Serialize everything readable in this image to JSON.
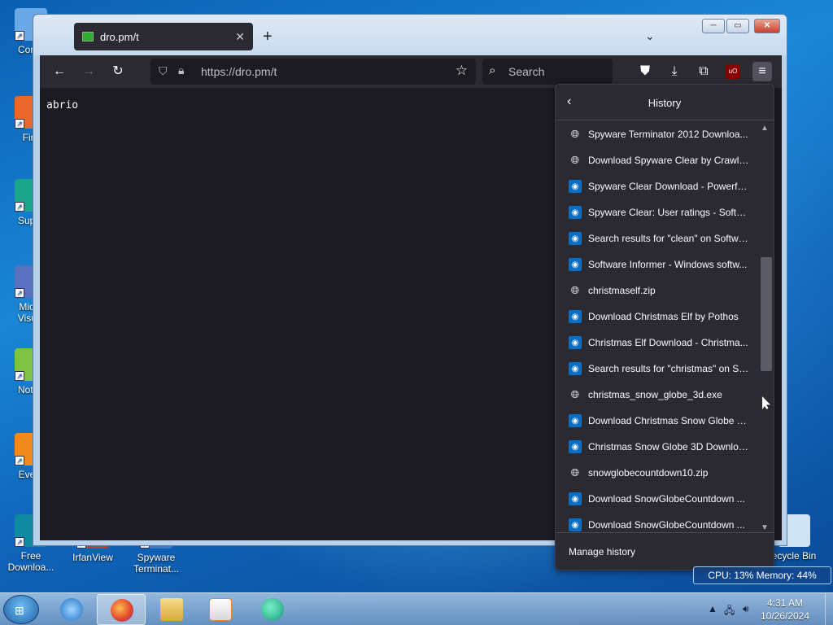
{
  "desktop": {
    "icons": [
      {
        "label": "Comp",
        "color": "#6aa8e6"
      },
      {
        "label": "Fire",
        "color": "#e8672a"
      },
      {
        "label": "Super",
        "color": "#1aa58a"
      },
      {
        "label": "Micro\nVisual",
        "color": "#5b6fbf"
      },
      {
        "label": "Notep",
        "color": "#7fc243"
      },
      {
        "label": "Every",
        "color": "#f08a1c"
      },
      {
        "label": "Free\nDownloa...",
        "color": "#0f8aa1"
      },
      {
        "label": "IrfanView",
        "color": "#c23a3a"
      },
      {
        "label": "Spyware\nTerminat...",
        "color": "#3f7dcc"
      },
      {
        "label": "ecycle Bin",
        "color": "#cfe3f3"
      }
    ]
  },
  "browser": {
    "tab_title": "dro.pm/t",
    "tab_close": "✕",
    "new_tab": "+",
    "tab_list": "⌄",
    "window_min": "─",
    "window_max": "▭",
    "window_close": "✕",
    "url": "https://dro.pm/t",
    "search_placeholder": "Search",
    "ublock_label": "uO",
    "page_text": "abrio"
  },
  "history_panel": {
    "title": "History",
    "manage_label": "Manage history",
    "items": [
      {
        "label": "Spyware Terminator 2012 Downloa...",
        "icon": "globe-icon"
      },
      {
        "label": "Download Spyware Clear by Crawle...",
        "icon": "globe-icon"
      },
      {
        "label": "Spyware Clear Download - Powerfu...",
        "icon": "site-icon"
      },
      {
        "label": "Spyware Clear: User ratings - Softw...",
        "icon": "site-icon"
      },
      {
        "label": "Search results for \"clean\" on Softwa...",
        "icon": "site-icon"
      },
      {
        "label": "Software Informer - Windows softw...",
        "icon": "site-icon"
      },
      {
        "label": "christmaself.zip",
        "icon": "globe-icon"
      },
      {
        "label": "Download Christmas Elf by Pothos",
        "icon": "site-icon"
      },
      {
        "label": "Christmas Elf Download - Christma...",
        "icon": "site-icon"
      },
      {
        "label": "Search results for \"christmas\" on So...",
        "icon": "site-icon"
      },
      {
        "label": "christmas_snow_globe_3d.exe",
        "icon": "globe-icon"
      },
      {
        "label": "Download Christmas Snow Globe 3...",
        "icon": "site-icon"
      },
      {
        "label": "Christmas Snow Globe 3D Downloa...",
        "icon": "site-icon"
      },
      {
        "label": "snowglobecountdown10.zip",
        "icon": "globe-icon"
      },
      {
        "label": "Download SnowGlobeCountdown ...",
        "icon": "site-icon"
      },
      {
        "label": "Download SnowGlobeCountdown ...",
        "icon": "site-icon"
      }
    ]
  },
  "system_monitor": "CPU: 13%   Memory: 44%",
  "taskbar": {
    "time": "4:31 AM",
    "date": "10/26/2024"
  }
}
